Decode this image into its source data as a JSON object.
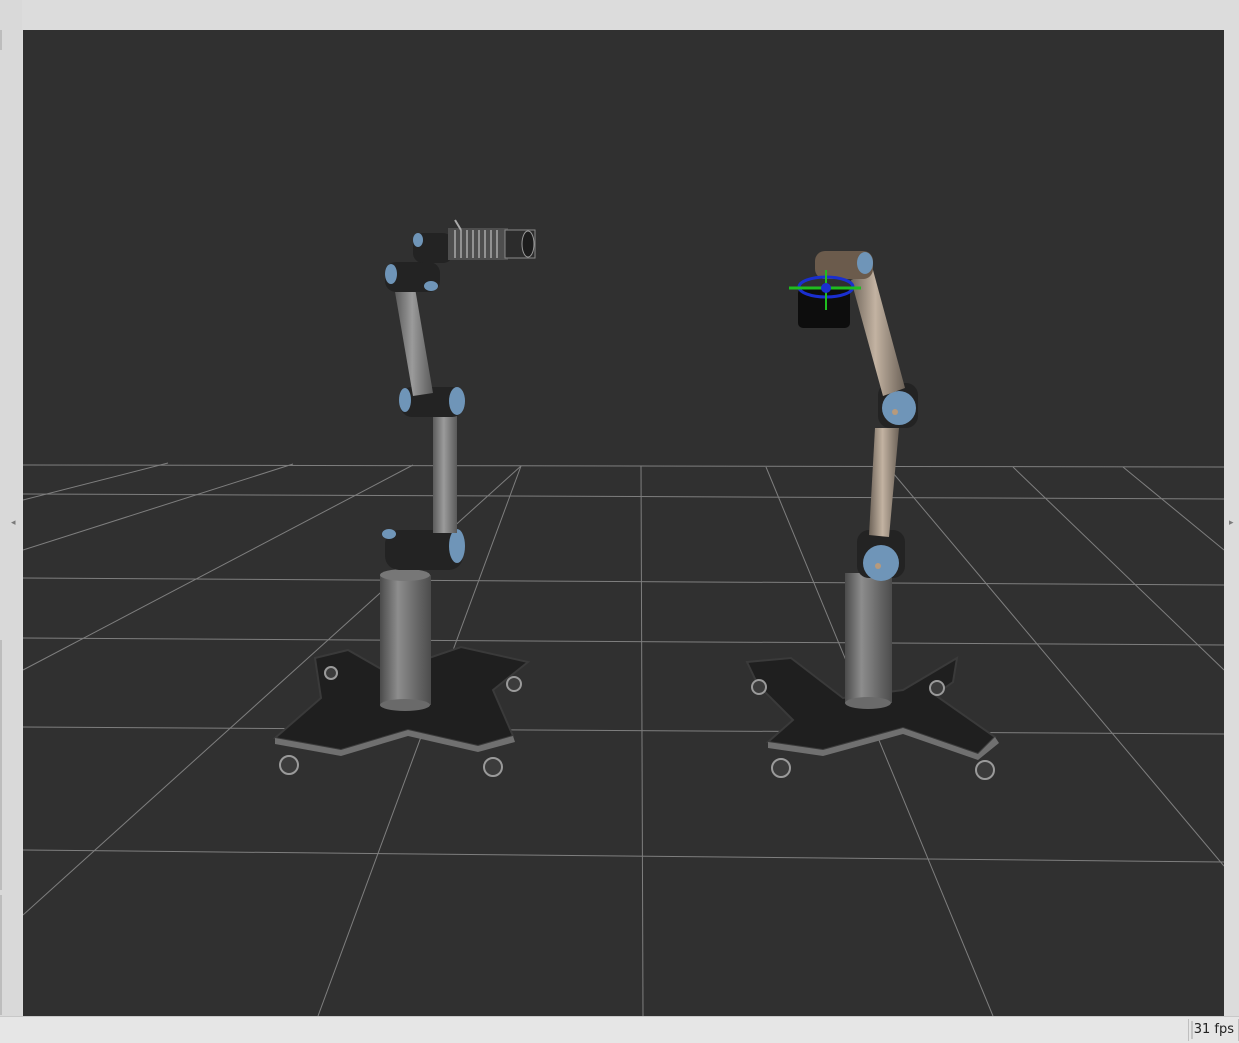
{
  "viewport": {
    "background": "#303030",
    "grid_color": "#8c8c8c",
    "scene": [
      "robot-arm-left",
      "robot-arm-right",
      "ground-grid"
    ]
  },
  "status_bar": {
    "fps_label": "31 fps"
  },
  "icons": {
    "left_collapse": "◂",
    "right_collapse": "▸"
  },
  "colors": {
    "joint_blue": "#6f95b8",
    "link_gray": "#8a8a8a",
    "highlight_tan": "#b79a7c"
  }
}
